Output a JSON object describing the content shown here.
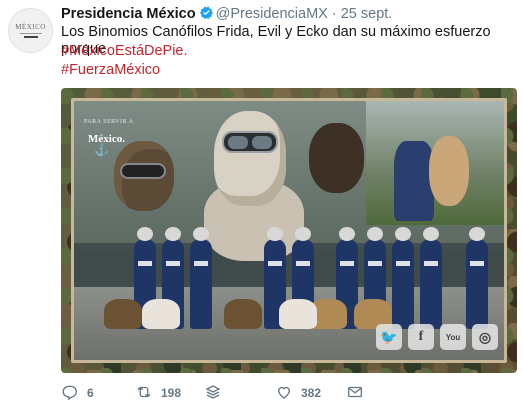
{
  "tweet": {
    "author_name": "Presidencia México",
    "handle": "@PresidenciaMX",
    "separator": "·",
    "date": "25 sept.",
    "avatar_text": "MÉXICO",
    "text_line1": "Los Binomios Canófilos Frida, Evil y Ecko dan su máximo esfuerzo porque",
    "hashtag1": "#MéxicoEstáDePie.",
    "hashtag2": "#FuerzaMéxico",
    "accent_color": "#c1272d",
    "verified_color": "#1da1f2"
  },
  "media": {
    "logo_small": "PARA SERVIR A",
    "logo_main": "México.",
    "social_icons": [
      {
        "name": "twitter-icon",
        "glyph": "🐦"
      },
      {
        "name": "facebook-icon",
        "glyph": "f"
      },
      {
        "name": "youtube-icon",
        "glyph": "You"
      },
      {
        "name": "instagram-icon",
        "glyph": "◎"
      }
    ]
  },
  "actions": {
    "reply_count": "6",
    "retweet_count": "198",
    "stack_icon": "layers-icon",
    "like_count": "382",
    "dm_icon": "mail-icon"
  }
}
